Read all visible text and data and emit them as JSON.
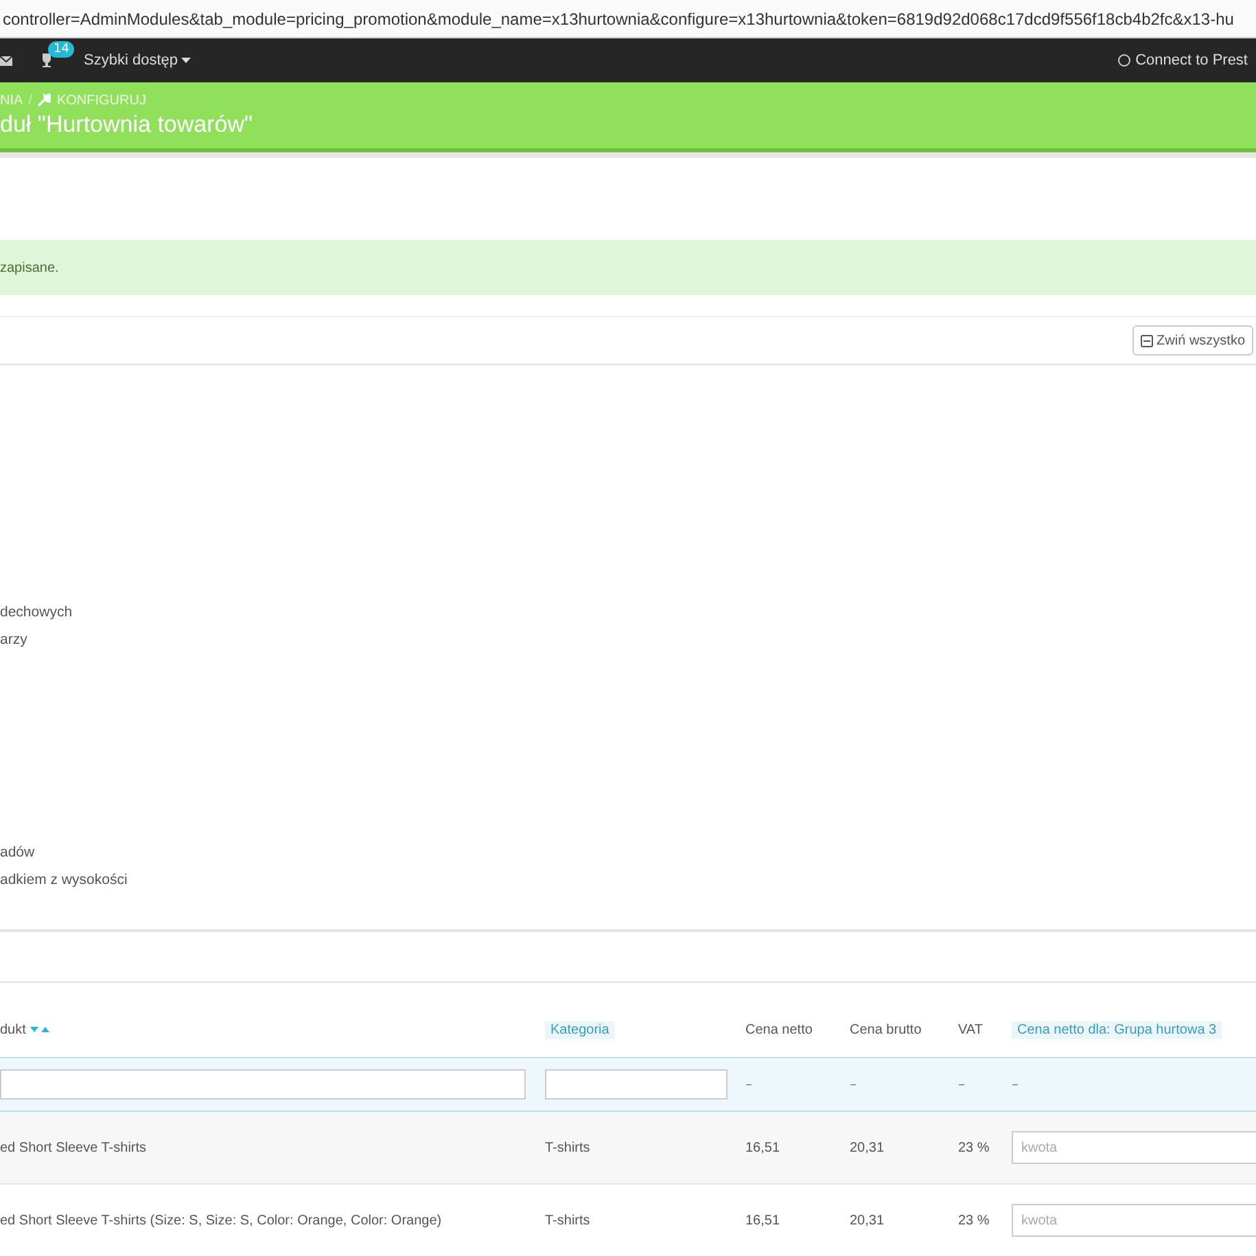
{
  "address_bar": {
    "url": "controller=AdminModules&tab_module=pricing_promotion&module_name=x13hurtownia&configure=x13hurtownia&token=6819d92d068c17dcd9f556f18cb4b2fc&x13-hu"
  },
  "top_nav": {
    "notification_count": "14",
    "quick_access": "Szybki dostęp",
    "connect": "Connect to Prest"
  },
  "header": {
    "breadcrumb": [
      "NIA",
      "KONFIGURUJ"
    ],
    "separator": "/",
    "title": "duł \"Hurtownia towarów\""
  },
  "alert": {
    "text": "zapisane."
  },
  "panel": {
    "collapse_button": "Zwiń wszystko"
  },
  "tree_items": [
    {
      "label": "dechowych"
    },
    {
      "label": "arzy"
    },
    {
      "label": "adów"
    },
    {
      "label": "adkiem z wysokości"
    }
  ],
  "table": {
    "columns": [
      {
        "label": "dukt",
        "kind": "sortable"
      },
      {
        "label": "Kategoria",
        "kind": "filter"
      },
      {
        "label": "Cena netto",
        "kind": "plain"
      },
      {
        "label": "Cena brutto",
        "kind": "plain"
      },
      {
        "label": "VAT",
        "kind": "plain"
      },
      {
        "label": "Cena netto dla: Grupa hurtowa 3",
        "kind": "filter"
      }
    ],
    "filters": [
      {
        "kind": "input"
      },
      {
        "kind": "input"
      },
      {
        "kind": "dash",
        "text": "–"
      },
      {
        "kind": "dash",
        "text": "–"
      },
      {
        "kind": "dash",
        "text": "–"
      },
      {
        "kind": "dash",
        "text": "–"
      }
    ],
    "rows": [
      {
        "product": "ed Short Sleeve T-shirts",
        "category": "T-shirts",
        "net": "16,51",
        "gross": "20,31",
        "vat": "23 %",
        "price_placeholder": "kwota"
      },
      {
        "product": "ed Short Sleeve T-shirts (Size: S, Size: S, Color: Orange, Color: Orange)",
        "category": "T-shirts",
        "net": "16,51",
        "gross": "20,31",
        "vat": "23 %",
        "price_placeholder": "kwota"
      }
    ]
  }
}
